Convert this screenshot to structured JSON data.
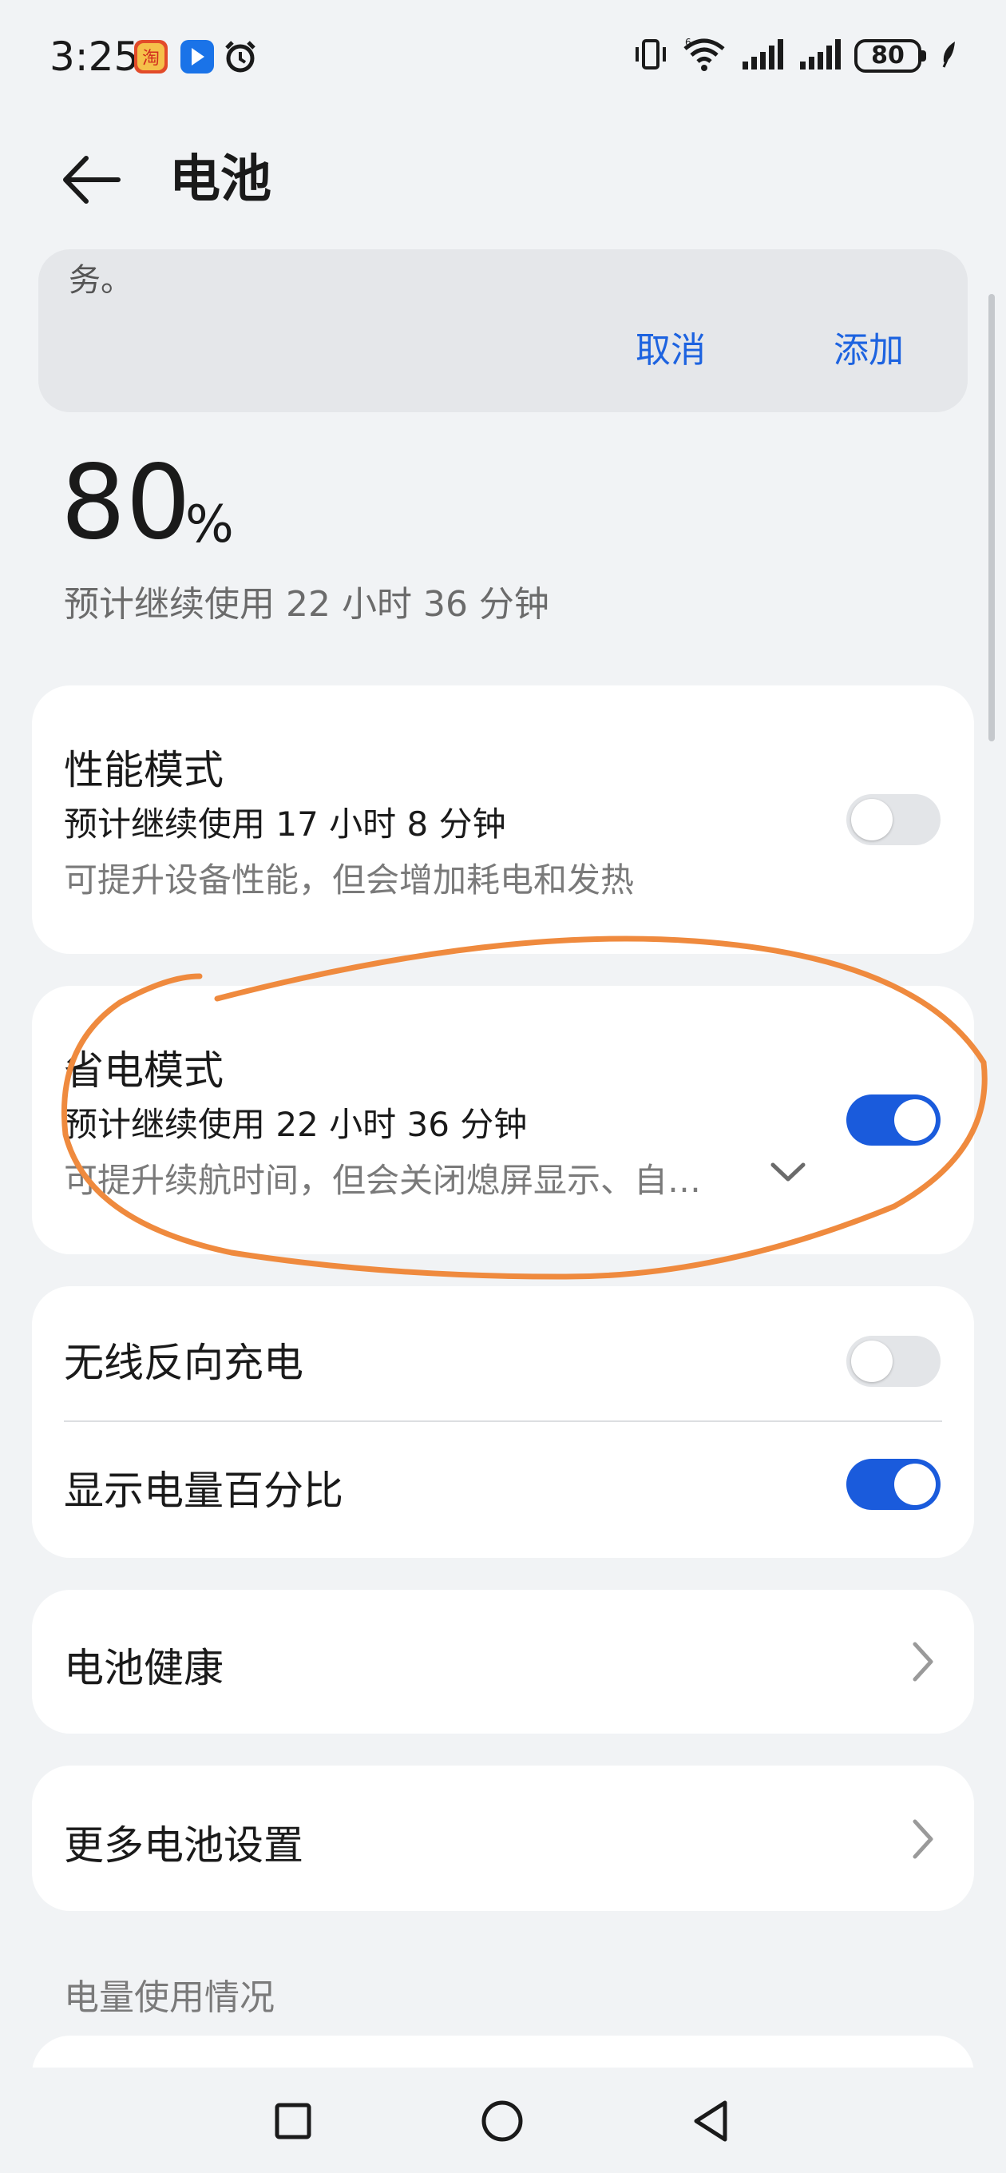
{
  "status_bar": {
    "time": "3:25",
    "battery_level": "80",
    "icons": [
      "taobao-app-icon",
      "blue-app-icon",
      "alarm-icon",
      "vibrate-icon",
      "wifi-6-icon",
      "signal-icon",
      "signal-icon-2",
      "battery-icon",
      "leaf-icon"
    ]
  },
  "header": {
    "title": "电池"
  },
  "dialog": {
    "text": "务。",
    "cancel_label": "取消",
    "add_label": "添加"
  },
  "battery": {
    "percent": "80",
    "percent_sign": "%",
    "remaining": "预计继续使用 22 小时 36 分钟"
  },
  "performance_mode": {
    "title": "性能模式",
    "estimate": "预计继续使用 17 小时 8 分钟",
    "description": "可提升设备性能，但会增加耗电和发热",
    "enabled": false
  },
  "power_saving_mode": {
    "title": "省电模式",
    "estimate": "预计继续使用 22 小时 36 分钟",
    "description": "可提升续航时间，但会关闭熄屏显示、自…",
    "enabled": true
  },
  "toggles": {
    "wireless_reverse_charge": {
      "label": "无线反向充电",
      "enabled": false
    },
    "show_percentage": {
      "label": "显示电量百分比",
      "enabled": true
    }
  },
  "links": {
    "battery_health": "电池健康",
    "more_settings": "更多电池设置"
  },
  "usage_section": {
    "label": "电量使用情况"
  },
  "colors": {
    "accent": "#1a5bdc",
    "link": "#1d63e0",
    "background": "#f1f3f5",
    "annotation": "#ef8a3e"
  }
}
